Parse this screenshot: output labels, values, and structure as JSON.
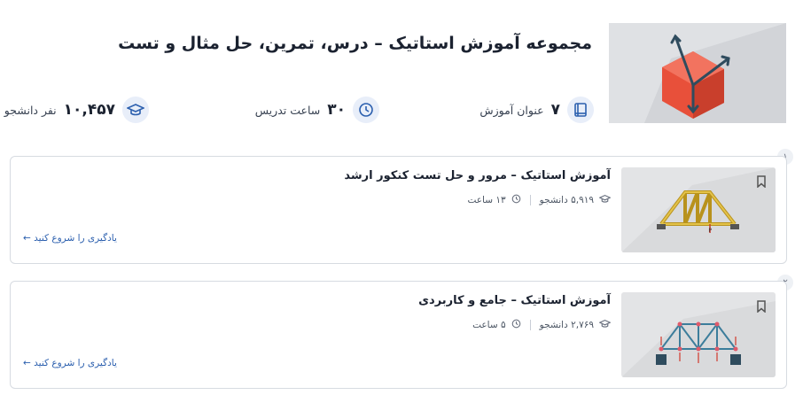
{
  "header": {
    "title": "مجموعه آموزش استاتیک – درس، تمرین، حل مثال و تست"
  },
  "stats": [
    {
      "value": "۷",
      "label": "عنوان آموزش",
      "icon": "book-icon"
    },
    {
      "value": "۳۰",
      "label": "ساعت تدریس",
      "icon": "clock-icon"
    },
    {
      "value": "۱۰,۴۵۷",
      "label": "نفر دانشجو",
      "icon": "graduation-cap-icon"
    }
  ],
  "courses": [
    {
      "index": "۱",
      "title": "آموزش استاتیک – مرور و حل تست کنکور ارشد",
      "students": "۵,۹۱۹ دانشجو",
      "hours": "۱۳ ساعت",
      "cta": "یادگیری را شروع کنید ←"
    },
    {
      "index": "۲",
      "title": "آموزش استاتیک – جامع و کاربردی",
      "students": "۲,۷۶۹ دانشجو",
      "hours": "۵ ساعت",
      "cta": "یادگیری را شروع کنید ←"
    }
  ],
  "colors": {
    "accent_blue": "#2b5fae",
    "cube_red": "#e8503a",
    "truss_yellow": "#d8b22a",
    "truss_teal": "#3c7d9b"
  }
}
